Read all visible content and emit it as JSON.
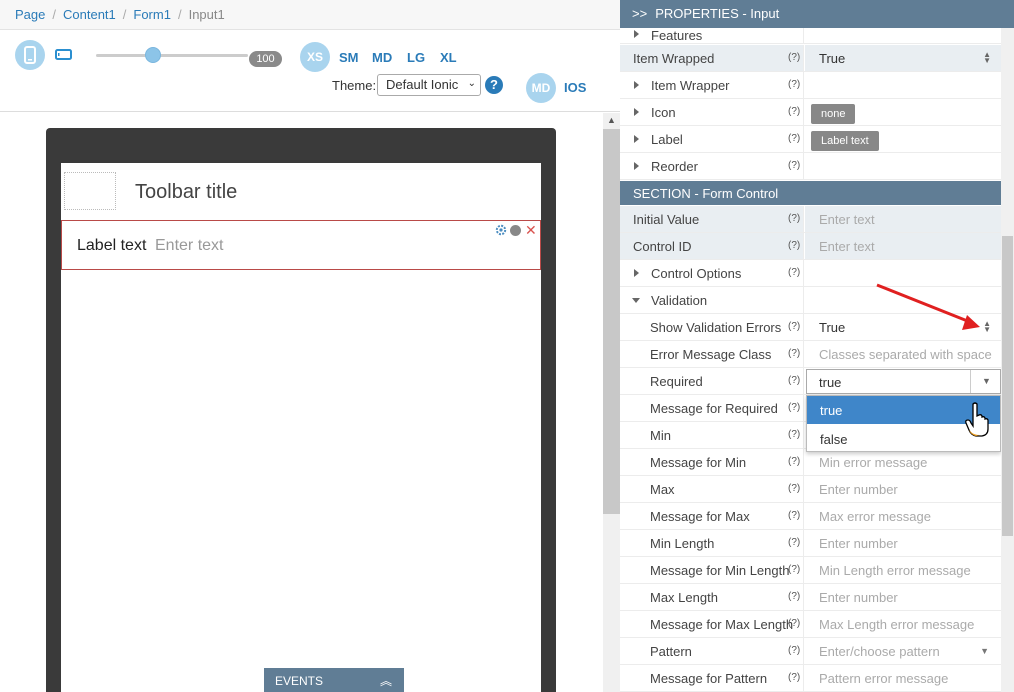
{
  "breadcrumb": [
    "Page",
    "Content1",
    "Form1",
    "Input1"
  ],
  "toolbar": {
    "slider_value": "100",
    "breakpoints": [
      "XS",
      "SM",
      "MD",
      "LG",
      "XL"
    ],
    "theme_label": "Theme:",
    "theme_value": "Default Ionic",
    "help": "?",
    "modes": [
      "MD",
      "IOS"
    ]
  },
  "preview": {
    "toolbar_title": "Toolbar title",
    "item_label": "Label text",
    "item_placeholder": "Enter text",
    "close_glyph": "✕"
  },
  "events": {
    "label": "EVENTS"
  },
  "properties": {
    "header": "PROPERTIES - Input",
    "help_mark": "(?)",
    "rows_top": [
      {
        "label": "Features",
        "value": ""
      },
      {
        "label": "Item Wrapped",
        "value": "True"
      },
      {
        "label": "Item Wrapper",
        "value": ""
      },
      {
        "label": "Icon",
        "value": "none"
      },
      {
        "label": "Label",
        "value": "Label text"
      },
      {
        "label": "Reorder",
        "value": ""
      }
    ],
    "section_form": "SECTION - Form Control",
    "rows_form": [
      {
        "label": "Initial Value",
        "value": "Enter text"
      },
      {
        "label": "Control ID",
        "value": "Enter text"
      },
      {
        "label": "Control Options",
        "value": ""
      },
      {
        "label": "Validation",
        "value": ""
      },
      {
        "label": "Show Validation Errors",
        "value": "True"
      },
      {
        "label": "Error Message Class",
        "value": "Classes separated with space"
      },
      {
        "label": "Required",
        "value": "true"
      },
      {
        "label": "Message for Required",
        "value": ""
      },
      {
        "label": "Min",
        "value": ""
      },
      {
        "label": "Message for Min",
        "value": "Min error message"
      },
      {
        "label": "Max",
        "value": "Enter number"
      },
      {
        "label": "Message for Max",
        "value": "Max error message"
      },
      {
        "label": "Min Length",
        "value": "Enter number"
      },
      {
        "label": "Message for Min Length",
        "value": "Min Length error message"
      },
      {
        "label": "Max Length",
        "value": "Enter number"
      },
      {
        "label": "Message for Max Length",
        "value": "Max Length error message"
      },
      {
        "label": "Pattern",
        "value": "Enter/choose pattern"
      },
      {
        "label": "Message for Pattern",
        "value": "Pattern error message"
      }
    ],
    "required_options": [
      "true",
      "false"
    ]
  },
  "colors": {
    "accent": "#2a7bb8",
    "header_bg": "#607d95",
    "selected_option": "#3f86c9",
    "annotation_arrow": "#e02020"
  }
}
